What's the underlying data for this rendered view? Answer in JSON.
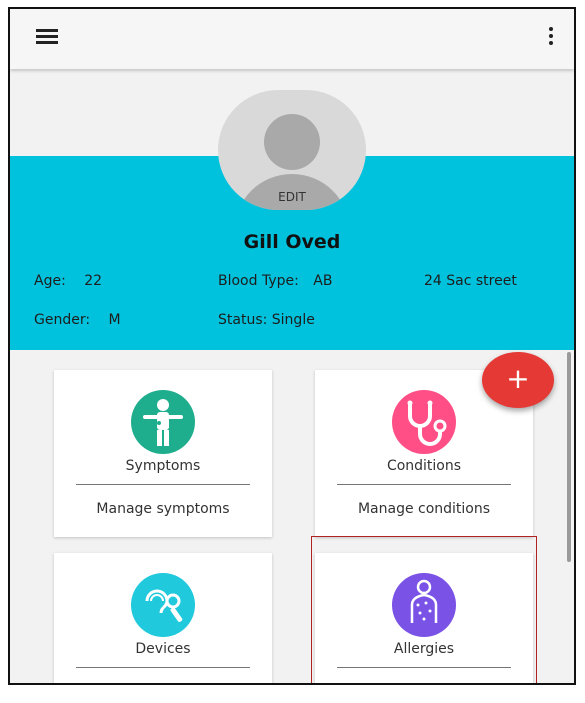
{
  "profile": {
    "edit_label": "EDIT",
    "name": "Gill Oved",
    "age_label": "Age:",
    "age_value": "22",
    "blood_type_label": "Blood Type:",
    "blood_type_value": "AB",
    "address": "24 Sac street",
    "gender_label": "Gender:",
    "gender_value": "M",
    "status": "Status: Single"
  },
  "cards": [
    {
      "title": "Symptoms",
      "subtitle": "Manage symptoms",
      "icon": "body-icon",
      "color": "#1fae8d"
    },
    {
      "title": "Conditions",
      "subtitle": "Manage conditions",
      "icon": "stethoscope-icon",
      "color": "#ff4f86"
    },
    {
      "title": "Devices",
      "subtitle": "",
      "icon": "hearing-aid-icon",
      "color": "#20c9dc"
    },
    {
      "title": "Allergies",
      "subtitle": "",
      "icon": "skin-icon",
      "color": "#7a52e6"
    }
  ],
  "fab": {
    "label": "+"
  },
  "colors": {
    "band": "#00c2dd",
    "fab": "#e53935"
  }
}
